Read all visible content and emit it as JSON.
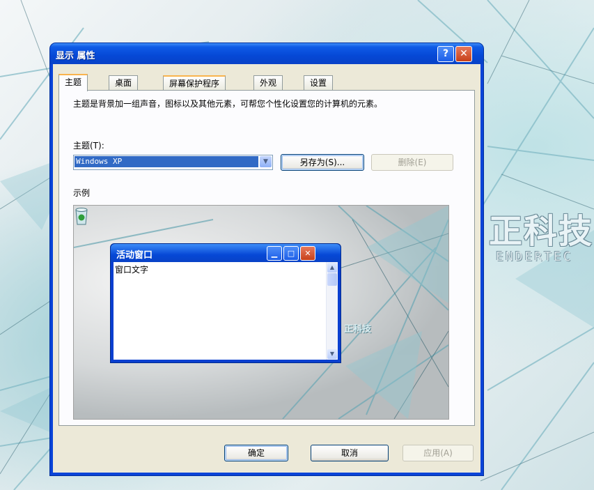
{
  "desktop": {
    "brand_text": "正科技",
    "brand_sub": "ENDERTEC"
  },
  "dialog": {
    "title": "显示 属性",
    "help_icon_glyph": "?",
    "close_icon_glyph": "✕",
    "tabs": [
      {
        "label": "主题",
        "active": true
      },
      {
        "label": "桌面",
        "active": false
      },
      {
        "label": "屏幕保护程序",
        "active": false
      },
      {
        "label": "外观",
        "active": false
      },
      {
        "label": "设置",
        "active": false
      }
    ],
    "description": "主题是背景加一组声音，图标以及其他元素，可帮您个性化设置您的计算机的元素。",
    "theme_label": "主题(T):",
    "theme_value": "Windows XP",
    "save_as_label": "另存为(S)...",
    "delete_label": "删除(E)",
    "sample_label": "示例",
    "preview": {
      "brand": "正科技",
      "window_title": "活动窗口",
      "window_text": "窗口文字"
    },
    "ok_label": "确定",
    "cancel_label": "取消",
    "apply_label": "应用(A)"
  }
}
